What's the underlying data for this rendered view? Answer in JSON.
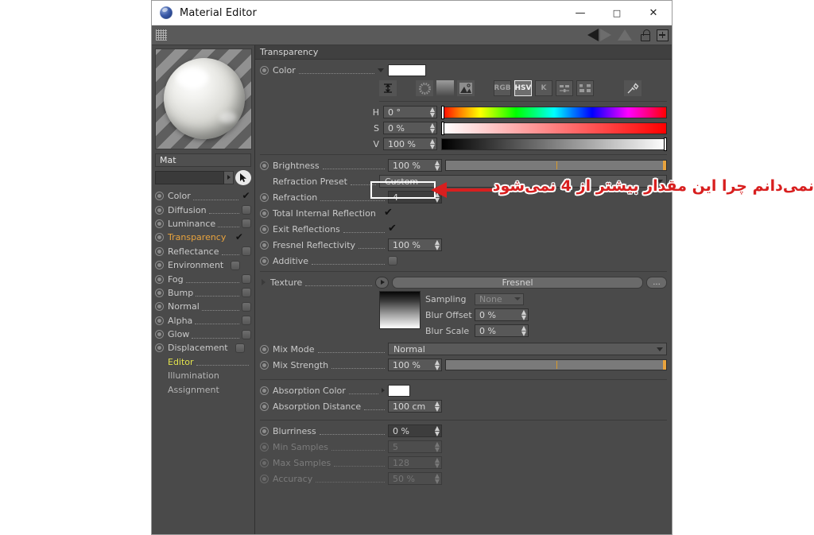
{
  "window": {
    "title": "Material Editor",
    "icon": "material-sphere-icon",
    "minimize": "—",
    "maximize": "□",
    "close": "✕"
  },
  "toolbar": {
    "grip": "drag-grip",
    "prev": "previous-material-arrow",
    "next": "next-material-arrow",
    "up": "up-triangle",
    "lock": "lock-icon",
    "add": "+"
  },
  "sidebar": {
    "preview_alt": "material-preview-sphere",
    "material_name": "Mat",
    "search_value": "",
    "channels": [
      {
        "label": "Color",
        "enabled": true,
        "type": "check"
      },
      {
        "label": "Diffusion",
        "enabled": false,
        "type": "box"
      },
      {
        "label": "Luminance",
        "enabled": false,
        "type": "box"
      },
      {
        "label": "Transparency",
        "enabled": true,
        "type": "check",
        "active": true
      },
      {
        "label": "Reflectance",
        "enabled": false,
        "type": "box"
      },
      {
        "label": "Environment",
        "enabled": false,
        "type": "box"
      },
      {
        "label": "Fog",
        "enabled": false,
        "type": "box"
      },
      {
        "label": "Bump",
        "enabled": false,
        "type": "box"
      },
      {
        "label": "Normal",
        "enabled": false,
        "type": "box"
      },
      {
        "label": "Alpha",
        "enabled": false,
        "type": "box"
      },
      {
        "label": "Glow",
        "enabled": false,
        "type": "box"
      },
      {
        "label": "Displacement",
        "enabled": false,
        "type": "box"
      }
    ],
    "sub_items": [
      {
        "label": "Editor",
        "highlight": true
      },
      {
        "label": "Illumination",
        "highlight": false
      },
      {
        "label": "Assignment",
        "highlight": false
      }
    ]
  },
  "panel": {
    "section_title": "Transparency",
    "color": {
      "label": "Color",
      "swatch": "#ffffff",
      "mode_buttons": [
        "RGB",
        "HSV",
        "K"
      ],
      "active_mode": "HSV",
      "icons": [
        "color-range-icon",
        "color-wheel-icon",
        "gradient-icon",
        "picture-icon",
        "sliders-icon",
        "swatches-icon",
        "eyedropper-icon"
      ],
      "channels": [
        {
          "key": "H",
          "value": "0 °",
          "bar": "hue-bar",
          "cursor": "left"
        },
        {
          "key": "S",
          "value": "0 %",
          "bar": "saturation-bar",
          "cursor": "left"
        },
        {
          "key": "V",
          "value": "100 %",
          "bar": "value-bar",
          "cursor": "right"
        }
      ]
    },
    "brightness": {
      "label": "Brightness",
      "value": "100 %"
    },
    "refraction_preset": {
      "label": "Refraction Preset",
      "value": "Custom"
    },
    "refraction": {
      "label": "Refraction",
      "value": "4",
      "highlighted": true
    },
    "total_internal_reflection": {
      "label": "Total Internal Reflection",
      "checked": true
    },
    "exit_reflections": {
      "label": "Exit Reflections",
      "checked": true
    },
    "fresnel_reflectivity": {
      "label": "Fresnel Reflectivity",
      "value": "100 %"
    },
    "additive": {
      "label": "Additive",
      "checked": false
    },
    "texture": {
      "label": "Texture",
      "value": "Fresnel",
      "more_button": "...",
      "sampling": {
        "label": "Sampling",
        "value": "None"
      },
      "blur_offset": {
        "label": "Blur Offset",
        "value": "0 %"
      },
      "blur_scale": {
        "label": "Blur Scale",
        "value": "0 %"
      }
    },
    "mix_mode": {
      "label": "Mix Mode",
      "value": "Normal"
    },
    "mix_strength": {
      "label": "Mix Strength",
      "value": "100 %"
    },
    "absorption_color": {
      "label": "Absorption Color",
      "swatch": "#ffffff"
    },
    "absorption_distance": {
      "label": "Absorption Distance",
      "value": "100 cm"
    },
    "blurriness": {
      "label": "Blurriness",
      "value": "0 %"
    },
    "min_samples": {
      "label": "Min Samples",
      "value": "5",
      "disabled": true
    },
    "max_samples": {
      "label": "Max Samples",
      "value": "128",
      "disabled": true
    },
    "accuracy": {
      "label": "Accuracy",
      "value": "50 %",
      "disabled": true
    }
  },
  "annotation": {
    "text": "نمی‌دانم چرا این مقدار بیشتر از 4 نمی‌شود",
    "color": "#d81f1f",
    "highlight_color": "#ffffff"
  }
}
